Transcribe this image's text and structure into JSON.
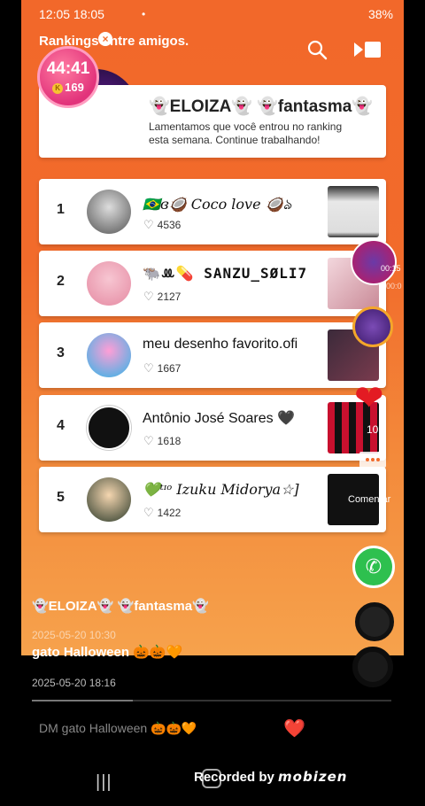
{
  "status_bar": {
    "time": "12:05 18:05",
    "indicators": "38%",
    "dot": "•"
  },
  "header": {
    "title": "Rankings entre amigos.",
    "close": "×",
    "search_icon": "search-icon",
    "share_icon": "share-icon"
  },
  "timer": {
    "time": "44:41",
    "coins": "169",
    "coin_letter": "K"
  },
  "profile": {
    "name": "👻ELOIZA👻 👻fantasma👻",
    "message": "Lamentamos que você entrou no ranking esta semana. Continue trabalhando!"
  },
  "ranking": [
    {
      "rank": "1",
      "name": "🇧🇷ɞ🥥 Coco love 🥥ঌ",
      "likes": "4536"
    },
    {
      "rank": "2",
      "name": "🐃ꔛ💊 SANZU_SØLI7",
      "likes": "2127"
    },
    {
      "rank": "3",
      "name": "meu desenho favorito.ofi",
      "likes": "1667"
    },
    {
      "rank": "4",
      "name": "Antônio José Soares 🖤",
      "likes": "1618"
    },
    {
      "rank": "5",
      "name": "💚ᵗᶦᵒ Izuku Midorya☆]",
      "likes": "1422"
    }
  ],
  "sidebar": {
    "live_time_1": "00:15",
    "live_time_2": "00:0",
    "heart_count": "10",
    "comment_label": "Comentar",
    "whatsapp_glyph": "✆"
  },
  "post": {
    "author": "👻ELOIZA👻 👻fantasma👻",
    "date": "2025-05-20 10:30",
    "text": "gato Halloween 🎃🎃🧡",
    "comment_date": "2025-05-20 18:16",
    "progress": 0.28
  },
  "input": {
    "placeholder": "DM gato Halloween 🎃🎃🧡"
  },
  "reactions": [
    "❤️",
    "😀",
    "😂"
  ],
  "footer": {
    "recorded_by": "Recorded by",
    "brand": "mobizen",
    "recent_apps": "|||"
  }
}
